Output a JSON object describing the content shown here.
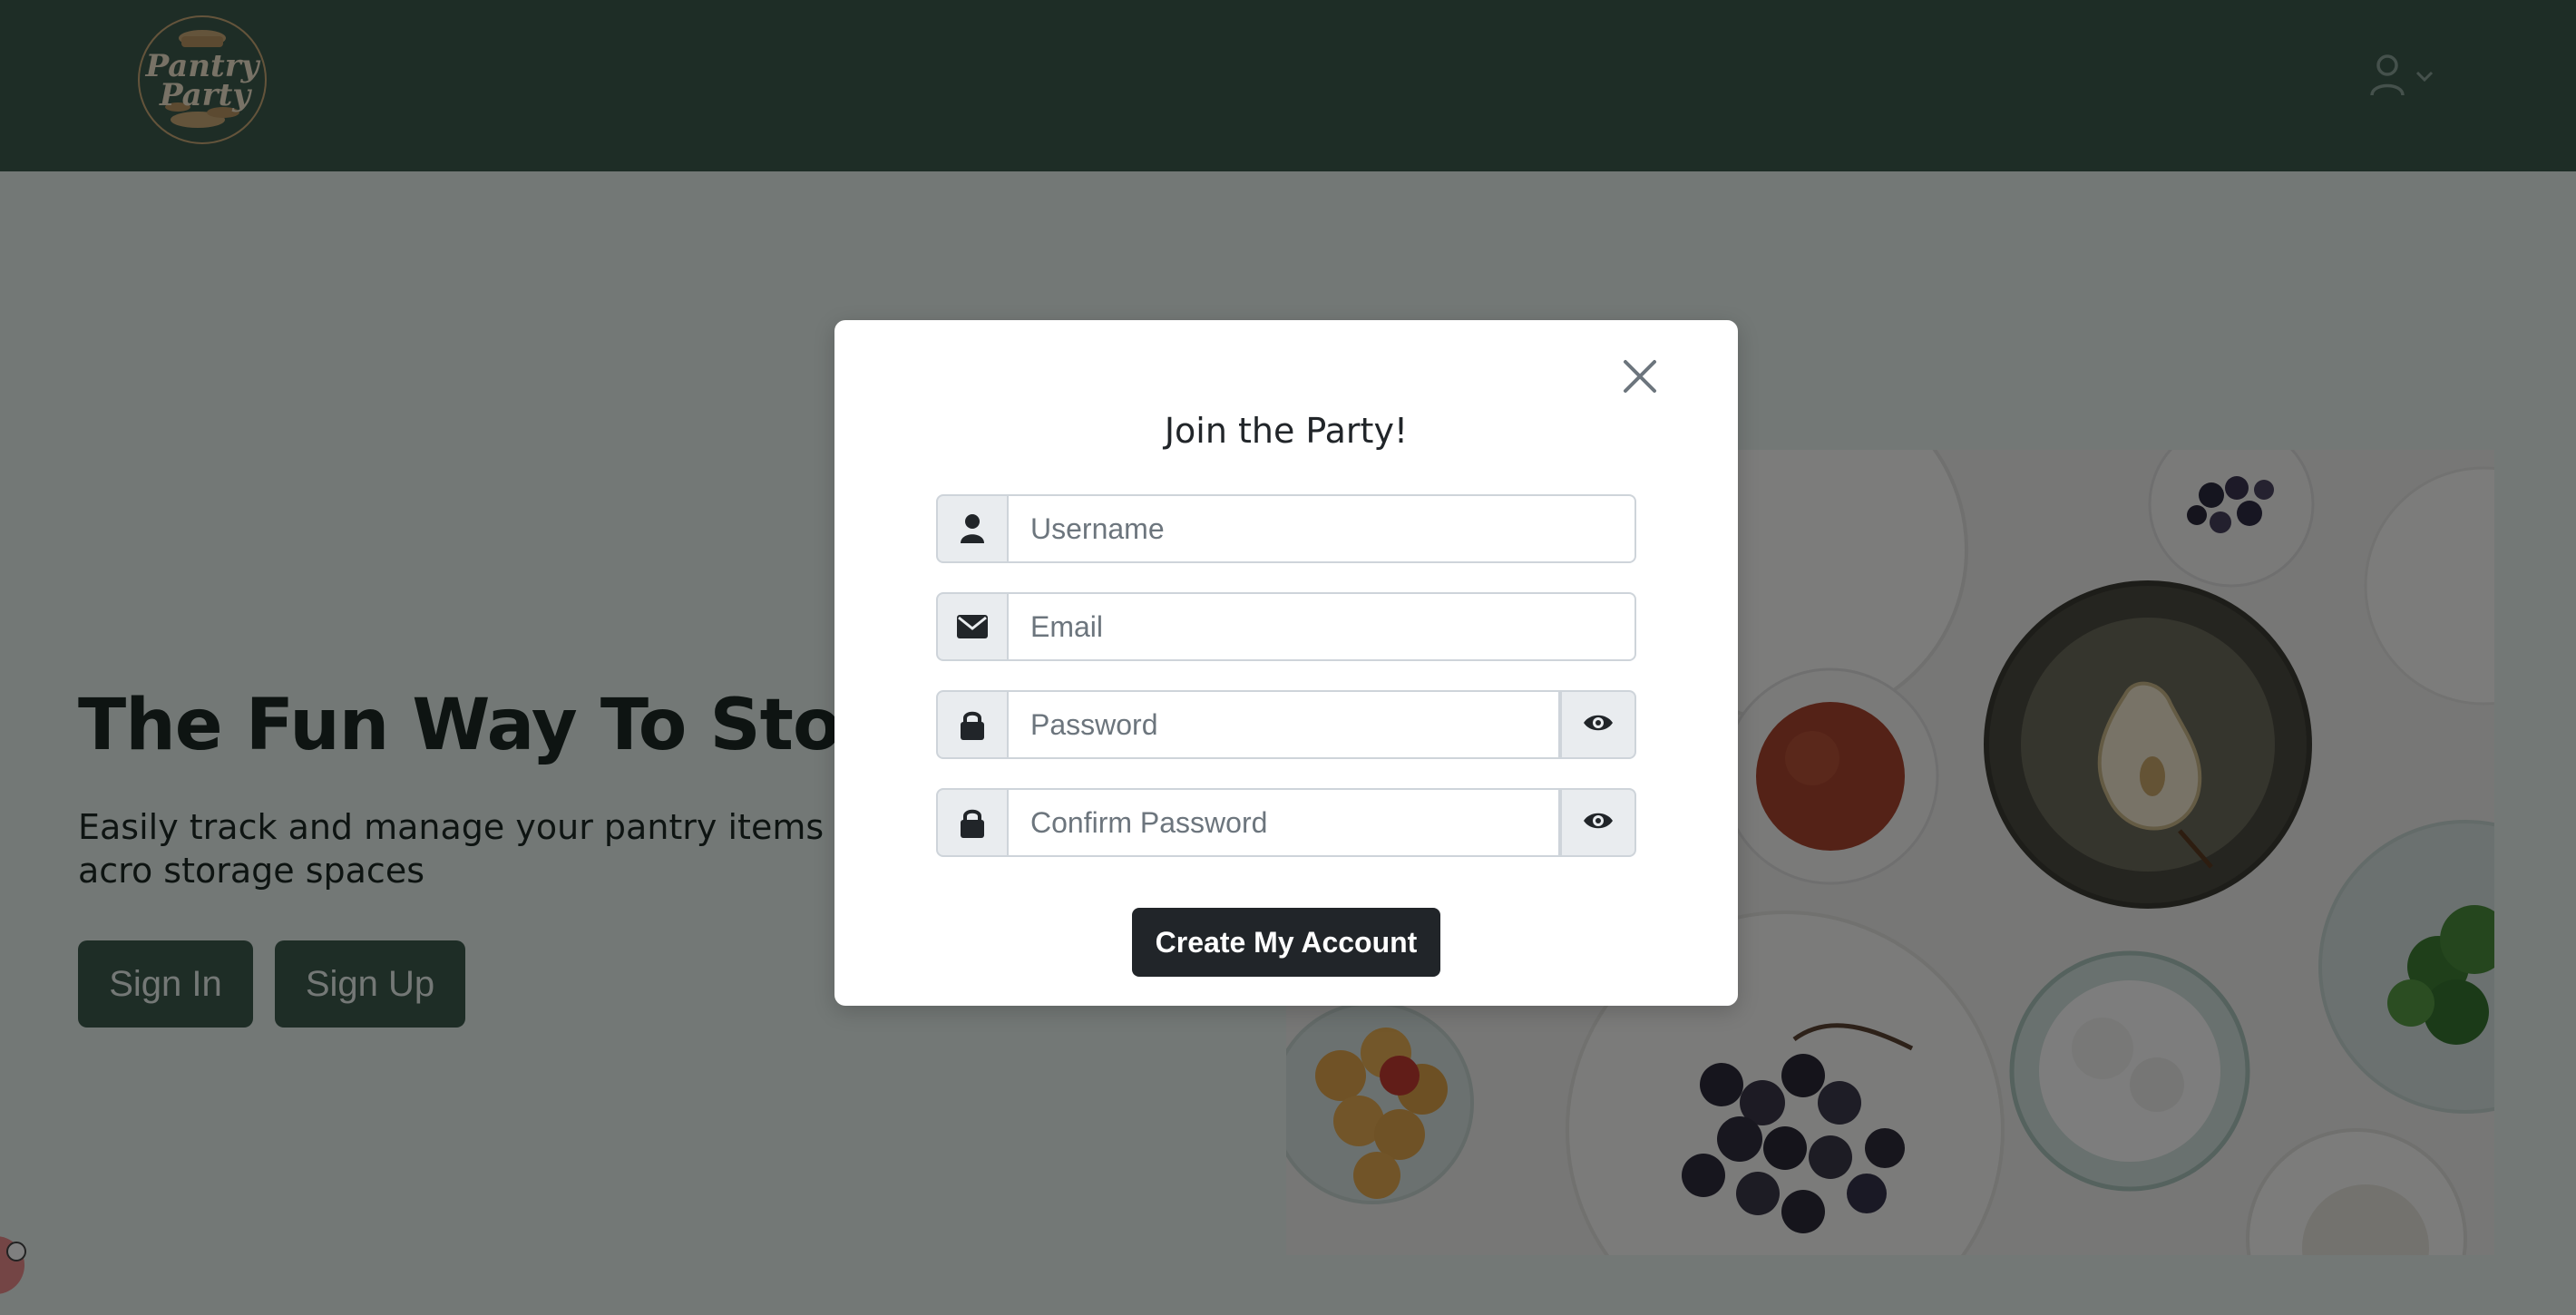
{
  "brand": {
    "logo_line1": "Pantry",
    "logo_line2": "Party"
  },
  "navbar": {
    "user_icon": "user-icon",
    "chevron_icon": "chevron-down-icon"
  },
  "hero": {
    "title": "The Fun Way To Stock Y",
    "subtitle": "Easily track and manage your pantry items acro storage spaces",
    "signin_label": "Sign In",
    "signup_label": "Sign Up"
  },
  "modal": {
    "title": "Join the Party!",
    "close_icon": "close-icon",
    "fields": {
      "username": {
        "placeholder": "Username",
        "value": "",
        "icon": "user-icon"
      },
      "email": {
        "placeholder": "Email",
        "value": "",
        "icon": "envelope-icon"
      },
      "password": {
        "placeholder": "Password",
        "value": "",
        "icon": "lock-icon",
        "toggle_icon": "eye-icon"
      },
      "confirm_password": {
        "placeholder": "Confirm Password",
        "value": "",
        "icon": "lock-icon",
        "toggle_icon": "eye-icon"
      }
    },
    "submit_label": "Create My Account"
  },
  "colors": {
    "navbar": "#3d5a4d",
    "hero_bg": "#e7f0ec",
    "primary_button": "#3d5a4d",
    "submit_button": "#212529",
    "backdrop": "rgba(0,0,0,0.5)"
  }
}
